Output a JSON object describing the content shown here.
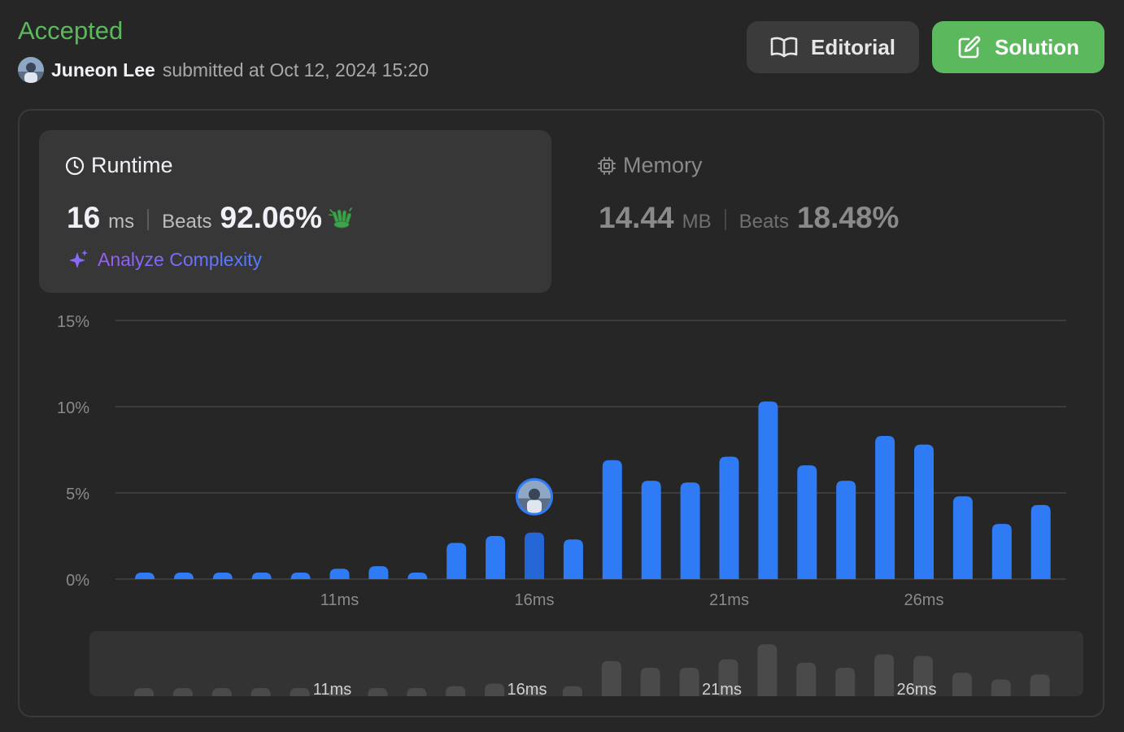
{
  "header": {
    "status": "Accepted",
    "submitter_name": "Juneon Lee",
    "submitted_text": "submitted at Oct 12, 2024 15:20",
    "editorial_label": "Editorial",
    "solution_label": "Solution"
  },
  "runtime": {
    "title": "Runtime",
    "value": "16",
    "unit": "ms",
    "beats_label": "Beats",
    "beats_value": "92.06%",
    "analyze_label": "Analyze Complexity"
  },
  "memory": {
    "title": "Memory",
    "value": "14.44",
    "unit": "MB",
    "beats_label": "Beats",
    "beats_value": "18.48%"
  },
  "colors": {
    "accepted": "#5cb85c",
    "bar": "#2f7bf5",
    "bar_current": "#2466d6",
    "brush_bar": "#4a4a4a",
    "grid": "#444444"
  },
  "icons": {
    "editorial": "book-open-icon",
    "solution": "edit-icon",
    "runtime": "clock-icon",
    "memory": "chip-icon",
    "analyze": "sparkle-icon",
    "beats": "clap-icon"
  },
  "chart_data": {
    "type": "bar",
    "x": [
      6,
      7,
      8,
      9,
      10,
      11,
      12,
      13,
      14,
      15,
      16,
      17,
      18,
      19,
      20,
      21,
      22,
      23,
      24,
      25,
      26,
      27,
      28,
      29
    ],
    "values": [
      0.35,
      0.35,
      0.35,
      0.35,
      0.35,
      0.6,
      0.75,
      0.35,
      2.1,
      2.5,
      2.7,
      2.3,
      6.9,
      5.7,
      5.6,
      7.1,
      10.3,
      6.6,
      5.7,
      8.3,
      7.8,
      4.8,
      3.2,
      4.3
    ],
    "highlight_x": 16,
    "ylim": [
      0,
      15
    ],
    "yticks": [
      "0%",
      "5%",
      "10%",
      "15%"
    ],
    "ytick_values": [
      0,
      5,
      10,
      15
    ],
    "xticks": [
      "11ms",
      "16ms",
      "21ms",
      "26ms"
    ],
    "xtick_values": [
      11,
      16,
      21,
      26
    ],
    "brush_values": [
      0.35,
      0.35,
      0.35,
      0.35,
      0.35,
      0.35,
      0.35,
      0.35,
      0.6,
      0.75,
      0.35,
      0.6,
      2.1,
      1.7,
      1.7,
      2.2,
      3.1,
      2.0,
      1.7,
      2.5,
      2.4,
      1.4,
      1.0,
      1.3
    ],
    "xlabel": "",
    "ylabel": ""
  }
}
